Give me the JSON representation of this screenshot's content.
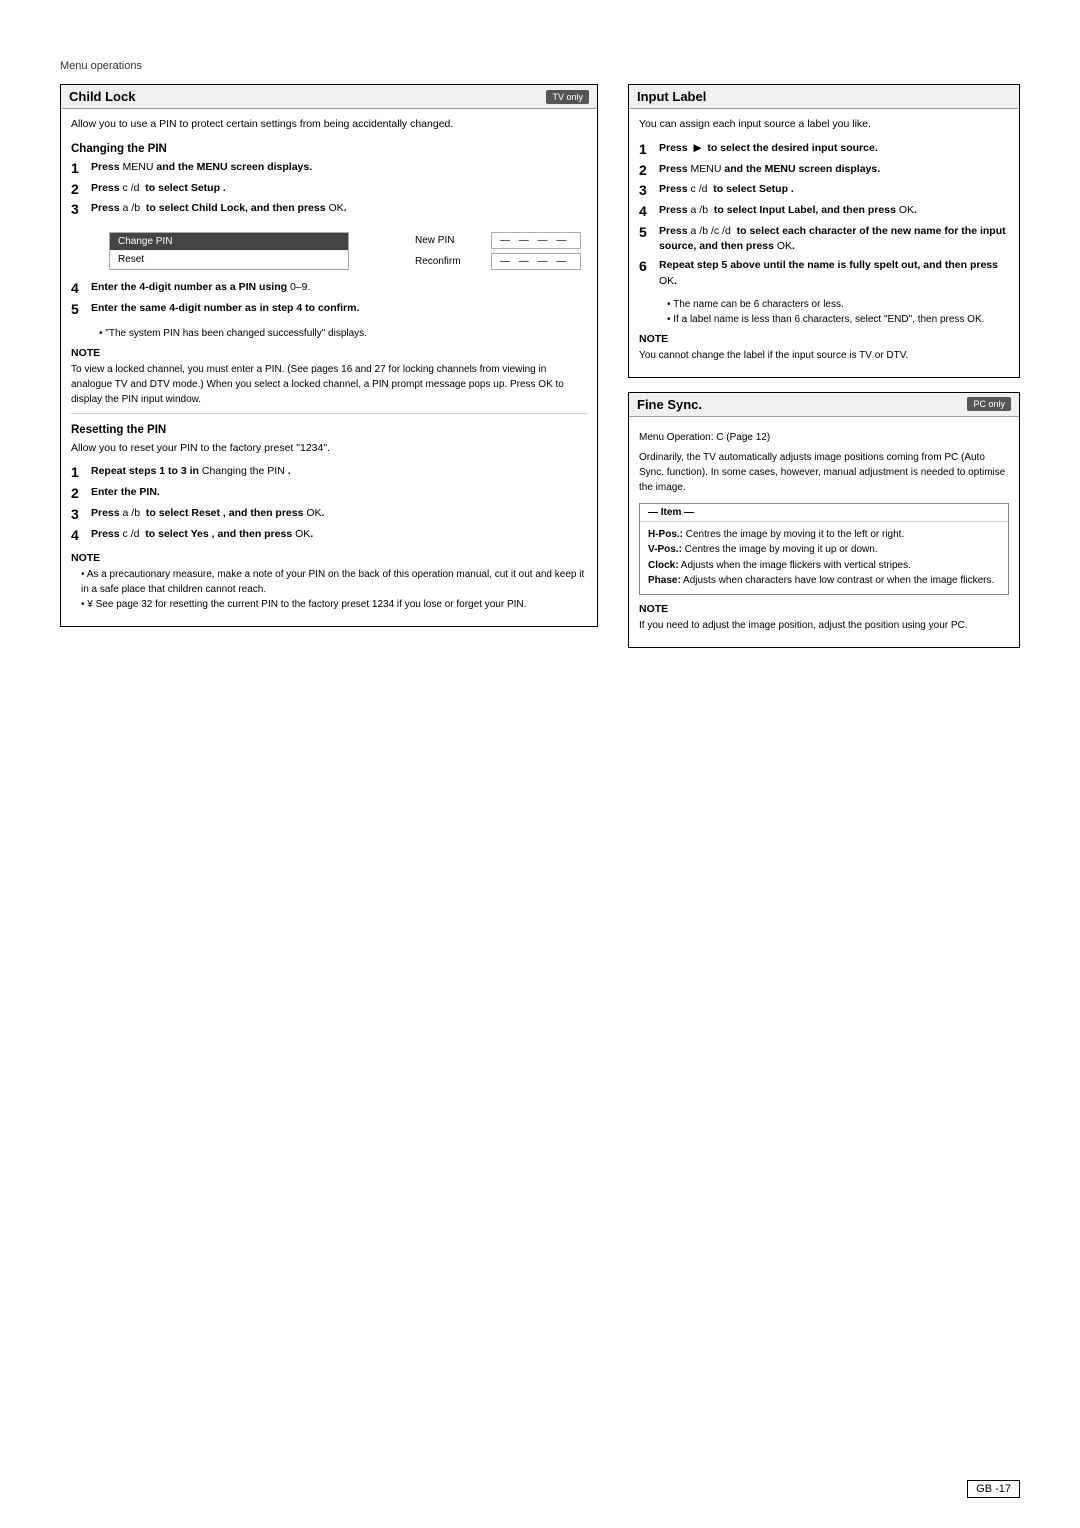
{
  "page": {
    "header": "Menu operations",
    "page_number": "GB -17"
  },
  "child_lock": {
    "title": "Child Lock",
    "badge": "TV only",
    "intro": "Allow you to use a PIN to protect certain settings from being accidentally changed.",
    "changing_pin": {
      "title": "Changing the PIN",
      "steps": [
        {
          "num": "1",
          "text": "Press MENU and the MENU screen displays.",
          "bold_prefix": "Press"
        },
        {
          "num": "2",
          "text": "Press c /d  to select Setup .",
          "bold_prefix": "Press"
        },
        {
          "num": "3",
          "text": "Press a /b  to select Child Lock, and then press OK.",
          "bold_prefix": "Press"
        }
      ],
      "screen": {
        "rows": [
          "Change PIN",
          "Reset"
        ],
        "inputs": [
          {
            "label": "New PIN",
            "value": "— — — —"
          },
          {
            "label": "Reconfirm",
            "value": "— — — —"
          }
        ]
      },
      "steps_after": [
        {
          "num": "4",
          "text": "Enter the 4-digit number as a PIN using 0–9."
        },
        {
          "num": "5",
          "text": "Enter the same 4-digit number as in step 4 to confirm."
        }
      ],
      "confirm_bullet": "\"The system PIN has been changed successfully\" displays."
    },
    "note": {
      "title": "NOTE",
      "text": "To view a locked channel, you must enter a PIN. (See pages 16 and 27 for locking channels from viewing in analogue TV and DTV mode.) When you select a locked channel, a PIN prompt message pops up. Press OK to display the PIN input window."
    },
    "resetting_pin": {
      "title": "Resetting the PIN",
      "intro": "Allow you to reset your PIN to the factory preset \"1234\".",
      "steps": [
        {
          "num": "1",
          "text": "Repeat steps 1 to 3 in Changing the PIN ."
        },
        {
          "num": "2",
          "text": "Enter the PIN."
        },
        {
          "num": "3",
          "text": "Press a /b  to select Reset , and then press OK."
        },
        {
          "num": "4",
          "text": "Press c /d  to select Yes , and then press OK."
        }
      ]
    },
    "note2": {
      "title": "NOTE",
      "bullets": [
        "As a precautionary measure, make a note of your PIN on the back of this operation manual, cut it out and keep it in a safe place that children cannot reach.",
        "¥  See page 32 for resetting the current PIN to the factory preset  1234  if you lose or forget your PIN."
      ]
    }
  },
  "input_label": {
    "title": "Input Label",
    "intro": "You can assign each input source a label you like.",
    "steps": [
      {
        "num": "1",
        "text": "Press       to select the desired input source.",
        "has_arrow": true
      },
      {
        "num": "2",
        "text": "Press MENU and the MENU screen displays."
      },
      {
        "num": "3",
        "text": "Press c /d  to select Setup ."
      },
      {
        "num": "4",
        "text": "Press a /b  to select Input Label, and then press OK."
      },
      {
        "num": "5",
        "text": "Press a /b /c /d  to select each character of the new name for the input source, and then press OK."
      },
      {
        "num": "6",
        "text": "Repeat step 5 above until the name is fully spelt out, and then press OK."
      }
    ],
    "step6_bullets": [
      "The name can be 6 characters or less.",
      "If a label name is less than 6 characters, select \"END\", then press OK."
    ],
    "note": {
      "title": "NOTE",
      "text": "You cannot change the label if the input source is TV or DTV."
    }
  },
  "fine_sync": {
    "title": "Fine Sync.",
    "badge": "PC only",
    "menu_op": "Menu Operation: C (Page 12)",
    "intro": "Ordinarily, the TV automatically adjusts image positions coming from PC (Auto Sync. function). In some cases, however, manual adjustment is needed to optimise the image.",
    "item_box": {
      "header": "Item",
      "items": [
        {
          "label": "H-Pos.:",
          "text": "Centres the image by moving it to the left or right."
        },
        {
          "label": "V-Pos.:",
          "text": "Centres the image by moving it up or down."
        },
        {
          "label": "Clock:",
          "text": "Adjusts when the image flickers with vertical stripes."
        },
        {
          "label": "Phase:",
          "text": "Adjusts when characters have low contrast or when the image flickers."
        }
      ]
    },
    "note": {
      "title": "NOTE",
      "text": "If you need to adjust the image position, adjust the position using your PC."
    }
  }
}
